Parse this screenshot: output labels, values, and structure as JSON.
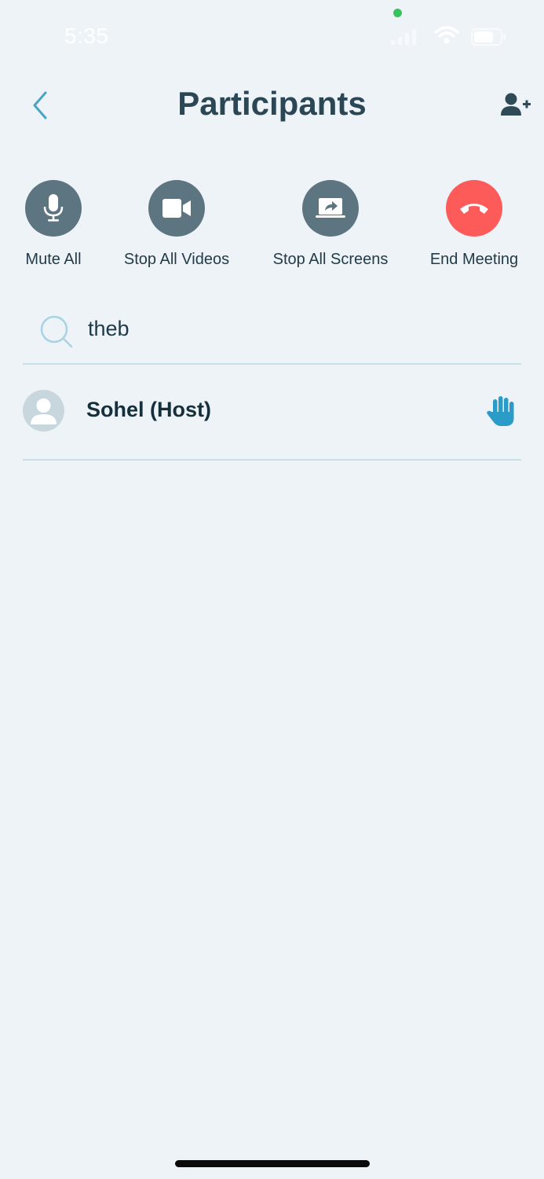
{
  "status_bar": {
    "time": "5:35"
  },
  "header": {
    "title": "Participants"
  },
  "actions": [
    {
      "label": "Mute All",
      "icon": "mic-icon"
    },
    {
      "label": "Stop All Videos",
      "icon": "video-camera-icon"
    },
    {
      "label": "Stop All Screens",
      "icon": "share-screen-icon"
    },
    {
      "label": "End Meeting",
      "icon": "hang-up-icon"
    }
  ],
  "search": {
    "value": "theb"
  },
  "participants": [
    {
      "name": "Sohel (Host)",
      "hand_raised": true
    }
  ],
  "colors": {
    "background": "#eef3f8",
    "action_button": "#5d7581",
    "end_meeting": "#fd5a5a",
    "accent": "#2a9cc7",
    "online_dot": "#36c35b"
  }
}
